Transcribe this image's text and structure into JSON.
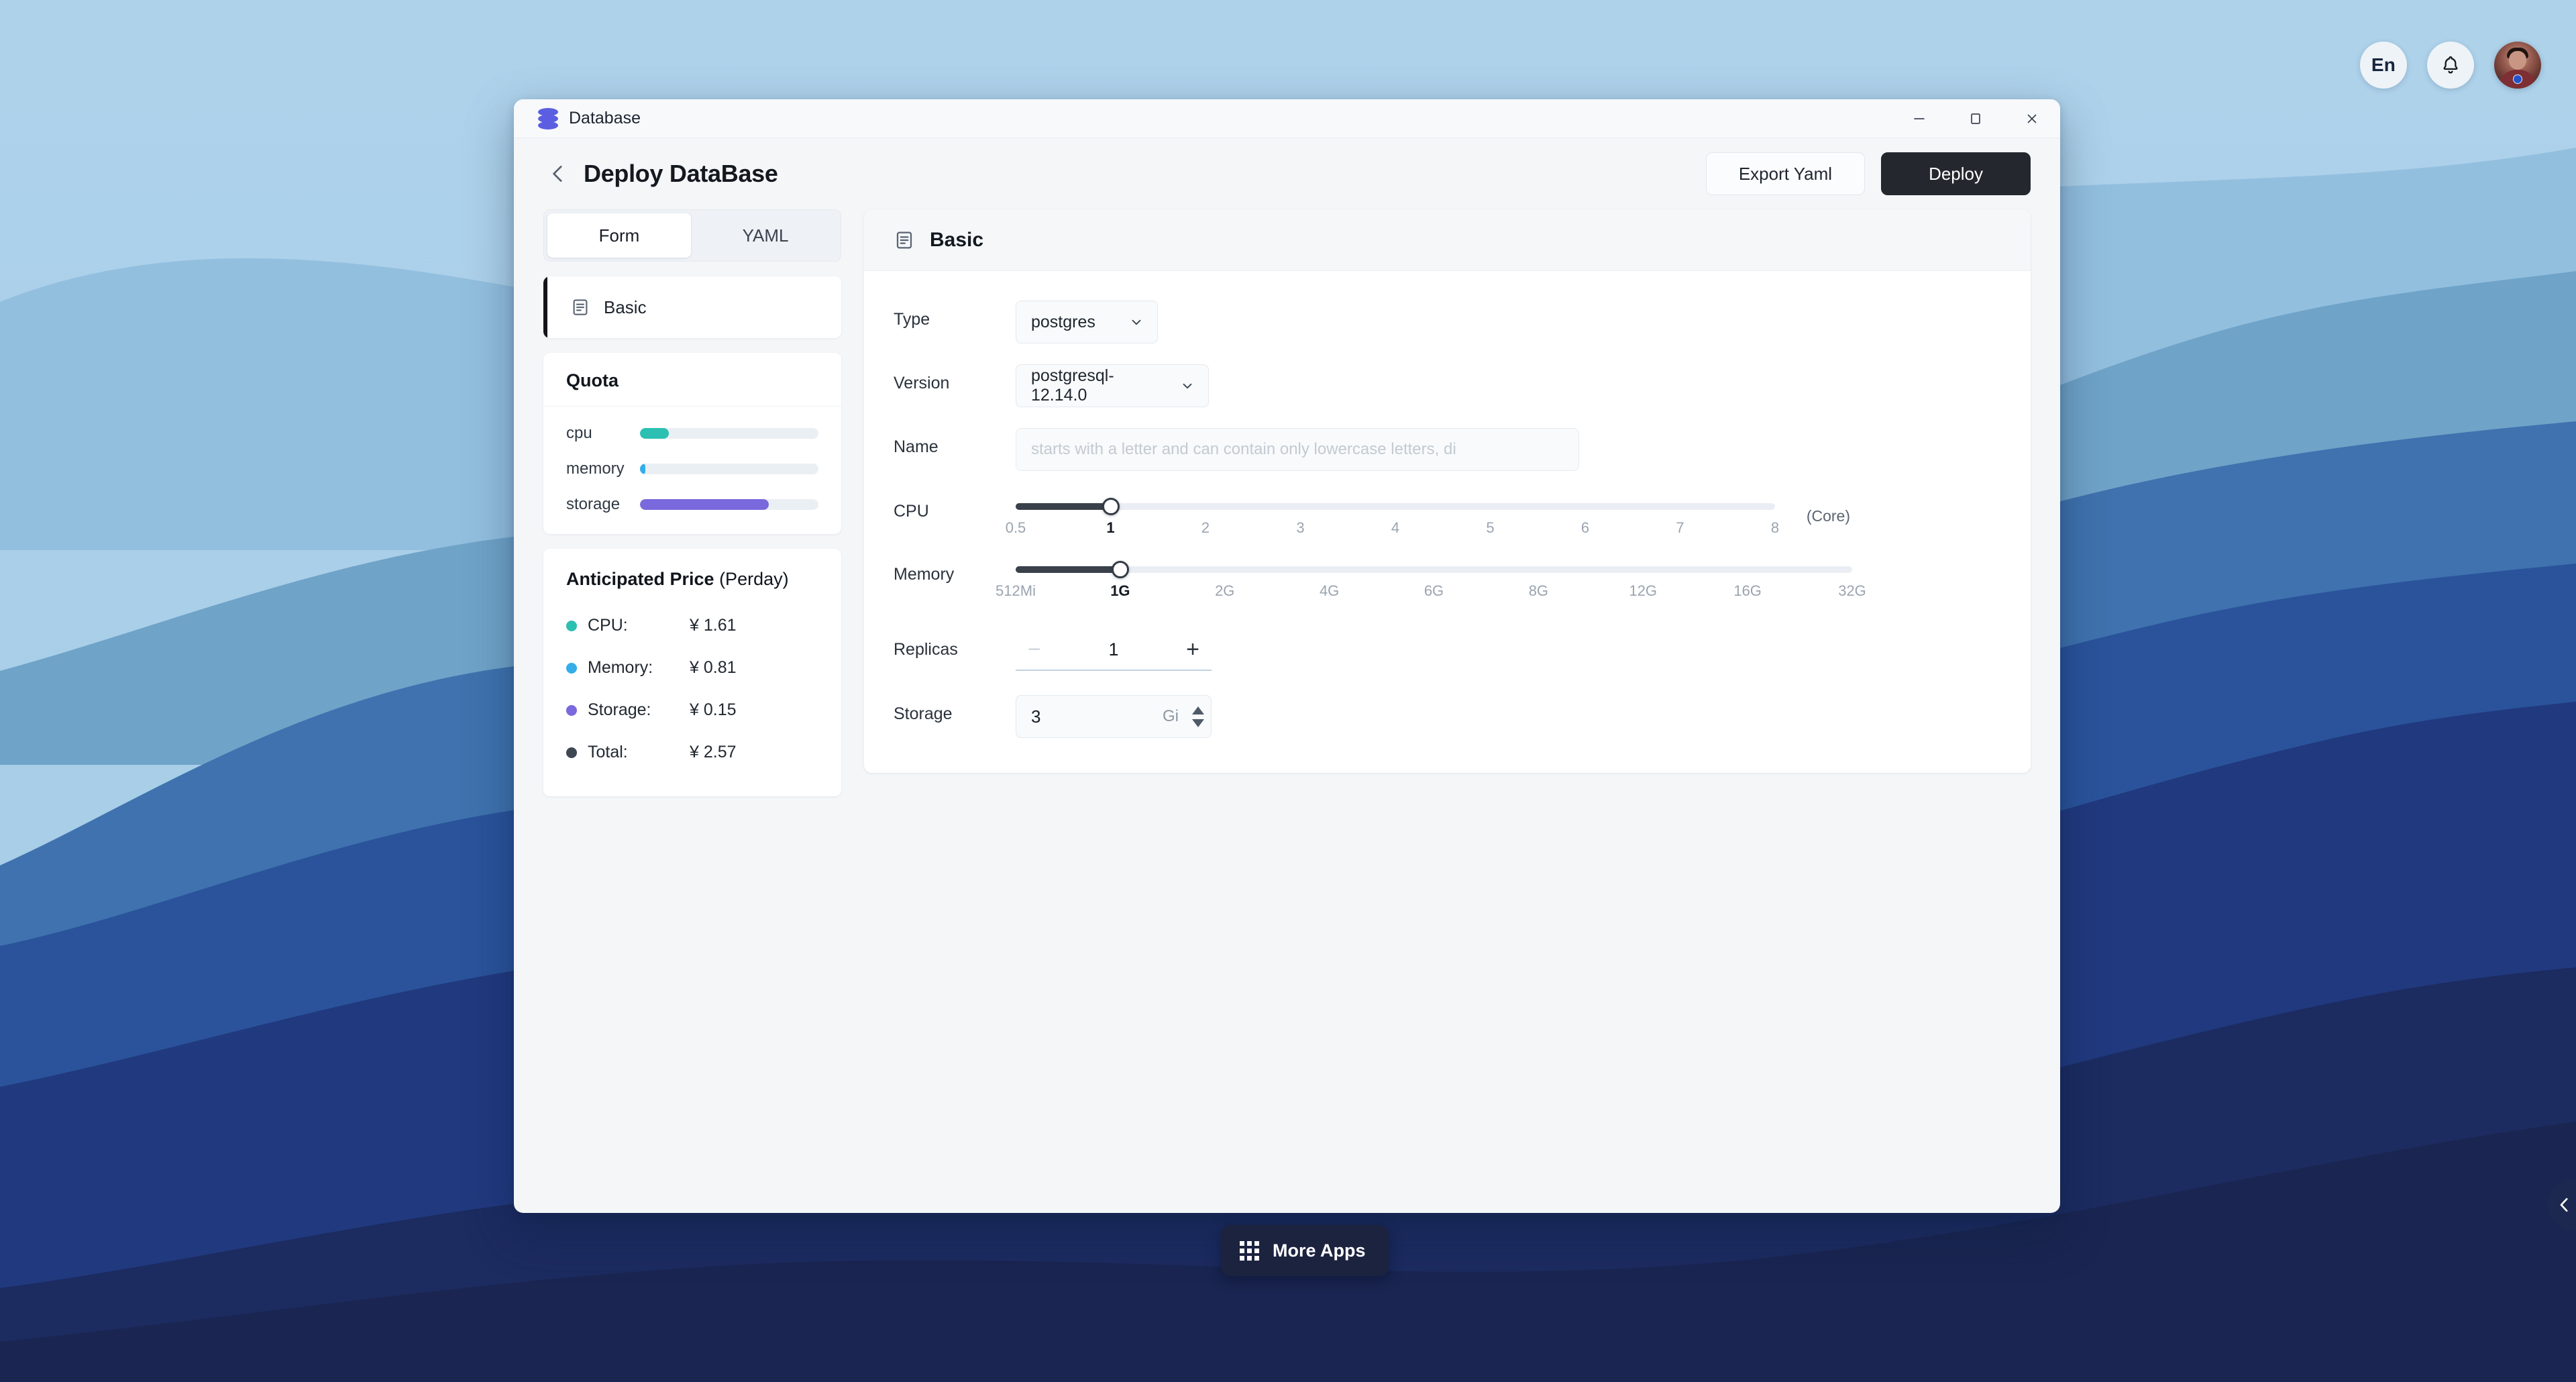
{
  "desktop": {
    "topbar": {
      "language_label": "En",
      "bell_icon": "bell-icon",
      "avatar_label": ""
    },
    "taskbar": {
      "more_apps_label": "More Apps",
      "grid_icon": "grid-icon"
    },
    "edge_toggle_icon": "chevron-left-icon"
  },
  "window": {
    "app_title": "Database",
    "app_icon": "database-icon",
    "controls": {
      "minimize": "minimize-icon",
      "maximize": "maximize-icon",
      "close": "close-icon"
    }
  },
  "header": {
    "back_icon": "chevron-left-icon",
    "page_title": "Deploy DataBase",
    "export_label": "Export Yaml",
    "deploy_label": "Deploy"
  },
  "sidebar": {
    "tabs": [
      {
        "label": "Form",
        "active": true
      },
      {
        "label": "YAML",
        "active": false
      }
    ],
    "nav": [
      {
        "label": "Basic",
        "icon": "document-icon",
        "active": true
      }
    ],
    "quota": {
      "title": "Quota",
      "rows": [
        {
          "label": "cpu",
          "percent": 16,
          "color": "#2cc0b3"
        },
        {
          "label": "memory",
          "percent": 3,
          "color": "#34ade9"
        },
        {
          "label": "storage",
          "percent": 72,
          "color": "#7a68dd"
        }
      ]
    },
    "price": {
      "title_bold": "Anticipated Price",
      "title_rest": " (Perday)",
      "rows": [
        {
          "name": "CPU:",
          "value": "¥ 1.61",
          "color": "#2cc0b3"
        },
        {
          "name": "Memory:",
          "value": "¥ 0.81",
          "color": "#34ade9"
        },
        {
          "name": "Storage:",
          "value": "¥ 0.15",
          "color": "#7a68dd"
        },
        {
          "name": "Total:",
          "value": "¥ 2.57",
          "color": "#3e4752"
        }
      ]
    }
  },
  "main": {
    "section_title": "Basic",
    "section_icon": "document-icon",
    "fields": {
      "type": {
        "label": "Type",
        "value": "postgres"
      },
      "version": {
        "label": "Version",
        "value": "postgresql-12.14.0"
      },
      "name": {
        "label": "Name",
        "value": "",
        "placeholder": "starts with a letter and can contain only lowercase letters, di"
      },
      "cpu": {
        "label": "CPU",
        "unit": "(Core)",
        "value": 1,
        "ticks": [
          "0.5",
          "1",
          "2",
          "3",
          "4",
          "5",
          "6",
          "7",
          "8"
        ],
        "active_tick_index": 1
      },
      "memory": {
        "label": "Memory",
        "value": "1G",
        "ticks": [
          "512Mi",
          "1G",
          "2G",
          "4G",
          "6G",
          "8G",
          "12G",
          "16G",
          "32G"
        ],
        "active_tick_index": 1
      },
      "replicas": {
        "label": "Replicas",
        "value": "1",
        "minus": "−",
        "plus": "+"
      },
      "storage": {
        "label": "Storage",
        "value": "3",
        "unit": "Gi"
      }
    }
  }
}
